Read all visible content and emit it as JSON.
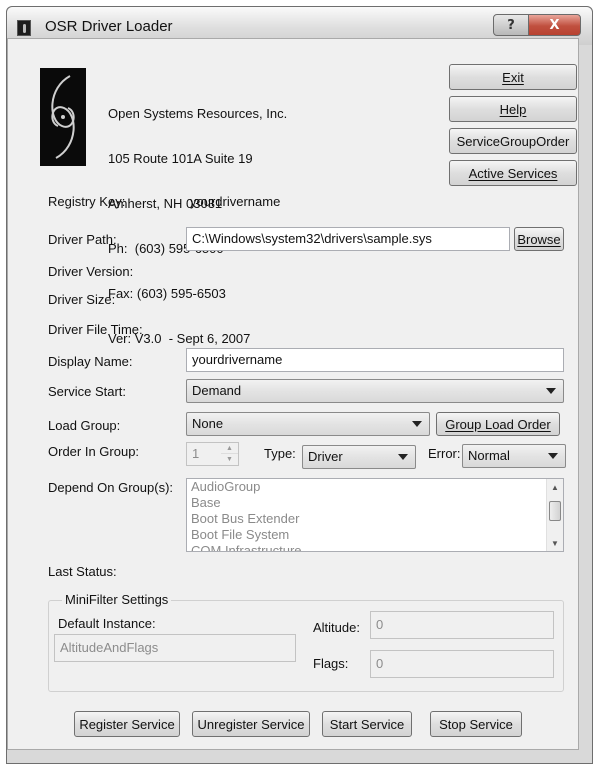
{
  "window": {
    "title": "OSR Driver Loader",
    "help_glyph": "?",
    "close_glyph": "X"
  },
  "company": {
    "lines": [
      "Open Systems Resources, Inc.",
      "105 Route 101A Suite 19",
      "Amherst, NH 03031",
      "Ph:  (603) 595-6500",
      "Fax: (603) 595-6503",
      "Ver: V3.0  - Sept 6, 2007"
    ]
  },
  "side_buttons": {
    "exit": "Exit",
    "help": "Help",
    "service_group_order": "ServiceGroupOrder",
    "active_services": "Active Services"
  },
  "registry": {
    "label": "Registry Key:",
    "value": "yourdrivername"
  },
  "driver_path": {
    "label": "Driver Path:",
    "value": "C:\\Windows\\system32\\drivers\\sample.sys",
    "browse": "Browse"
  },
  "driver_version": {
    "label": "Driver Version:"
  },
  "driver_size": {
    "label": "Driver Size:"
  },
  "driver_file_time": {
    "label": "Driver File Time:"
  },
  "display_name": {
    "label": "Display Name:",
    "value": "yourdrivername"
  },
  "service_start": {
    "label": "Service Start:",
    "value": "Demand"
  },
  "load_group": {
    "label": "Load Group:",
    "value": "None",
    "button": "Group Load Order"
  },
  "order_in_group": {
    "label": "Order In Group:",
    "value": "1"
  },
  "type": {
    "label": "Type:",
    "value": "Driver"
  },
  "error": {
    "label": "Error:",
    "value": "Normal"
  },
  "depend": {
    "label": "Depend On Group(s):",
    "items": [
      "AudioGroup",
      "Base",
      "Boot Bus Extender",
      "Boot File System",
      "COM Infrastructure"
    ]
  },
  "last_status": {
    "label": "Last Status:"
  },
  "minifilter": {
    "title": "MiniFilter Settings",
    "default_instance_label": "Default Instance:",
    "default_instance_value": "AltitudeAndFlags",
    "altitude_label": "Altitude:",
    "altitude_value": "0",
    "flags_label": "Flags:",
    "flags_value": "0"
  },
  "bottom_buttons": {
    "register": "Register Service",
    "unregister": "Unregister Service",
    "start": "Start Service",
    "stop": "Stop Service"
  }
}
